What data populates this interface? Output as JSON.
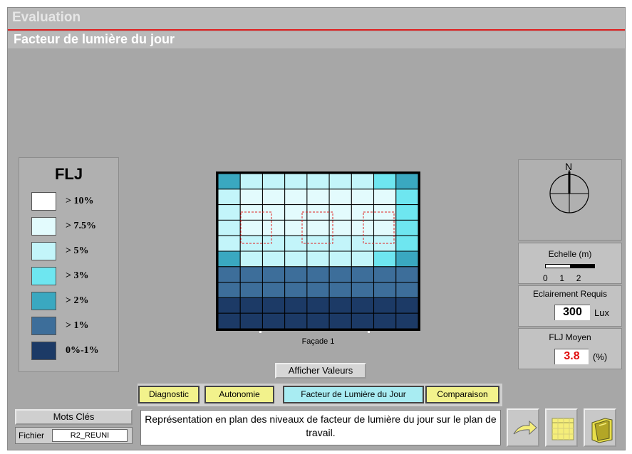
{
  "header": {
    "section": "Evaluation",
    "title": "Facteur de lumière du jour"
  },
  "legend": {
    "title": "FLJ",
    "items": [
      {
        "label": "> 10%",
        "color": "#ffffff"
      },
      {
        "label": "> 7.5%",
        "color": "#e3fbfd"
      },
      {
        "label": "> 5%",
        "color": "#c3f5fa"
      },
      {
        "label": "> 3%",
        "color": "#6ee6f0"
      },
      {
        "label": "> 2%",
        "color": "#3aa8c0"
      },
      {
        "label": "> 1%",
        "color": "#3d6e9a"
      },
      {
        "label": "0%-1%",
        "color": "#1c3a66"
      }
    ]
  },
  "plan": {
    "facade_label": "Façade 1",
    "grid": [
      [
        4,
        2,
        2,
        2,
        2,
        2,
        2,
        3,
        4
      ],
      [
        2,
        1,
        1,
        1,
        1,
        1,
        1,
        1,
        3
      ],
      [
        2,
        1,
        1,
        1,
        1,
        1,
        1,
        1,
        3
      ],
      [
        2,
        1,
        1,
        1,
        1,
        1,
        1,
        1,
        3
      ],
      [
        2,
        2,
        2,
        2,
        2,
        2,
        2,
        2,
        3
      ],
      [
        4,
        2,
        2,
        2,
        2,
        2,
        2,
        3,
        4
      ],
      [
        5,
        5,
        5,
        5,
        5,
        5,
        5,
        5,
        5
      ],
      [
        5,
        5,
        5,
        5,
        5,
        5,
        5,
        5,
        5
      ],
      [
        6,
        6,
        6,
        6,
        6,
        6,
        6,
        6,
        6
      ],
      [
        6,
        6,
        6,
        6,
        6,
        6,
        6,
        6,
        6
      ]
    ]
  },
  "compass": {
    "north_label": "N"
  },
  "scale": {
    "title": "Echelle (m)",
    "ticks": "0     1     2"
  },
  "eclairement": {
    "title": "Eclairement Requis",
    "value": "300",
    "unit": "Lux"
  },
  "flj_moyen": {
    "title": "FLJ Moyen",
    "value": "3.8",
    "unit": "(%)"
  },
  "buttons": {
    "afficher": "Afficher Valeurs",
    "mots_cles": "Mots Clés"
  },
  "tabs": [
    {
      "label": "Diagnostic",
      "active": false
    },
    {
      "label": "Autonomie",
      "active": false
    },
    {
      "label": "Facteur de Lumière du Jour",
      "active": true
    },
    {
      "label": "Comparaison",
      "active": false
    }
  ],
  "fichier": {
    "label": "Fichier",
    "value": "R2_REUNI"
  },
  "description": "Représentation en plan des niveaux de facteur de lumière du jour sur le plan de travail.",
  "icons": [
    "return-arrow-icon",
    "calendar-icon",
    "book-icon"
  ]
}
